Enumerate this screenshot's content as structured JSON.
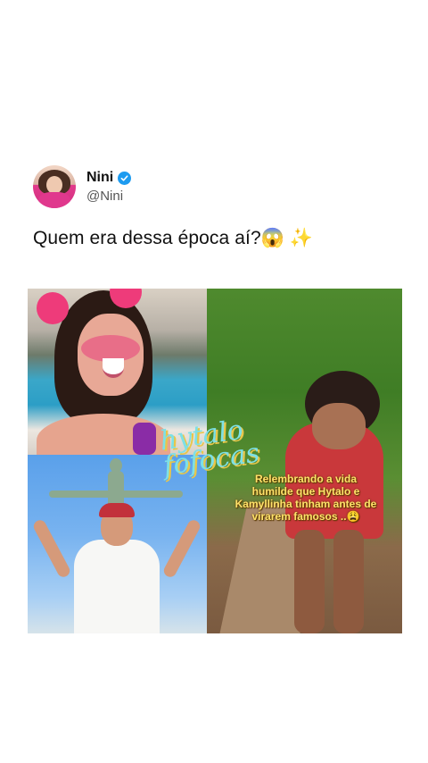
{
  "tweet": {
    "author": {
      "display_name": "Nini",
      "handle": "@Nini",
      "verified": true,
      "avatar_icon": "profile-photo"
    },
    "text": "Quem era dessa época aí?😱 ✨",
    "media": {
      "watermark": "hytalo\nfofocas",
      "caption": "Relembrando a vida humilde que Hytalo e Kamyllinha tinham antes de virarem famosos ..😩"
    }
  },
  "colors": {
    "verified_badge": "#1d9bf0",
    "caption_text": "#ffe26a",
    "watermark": "#7de0e6"
  }
}
